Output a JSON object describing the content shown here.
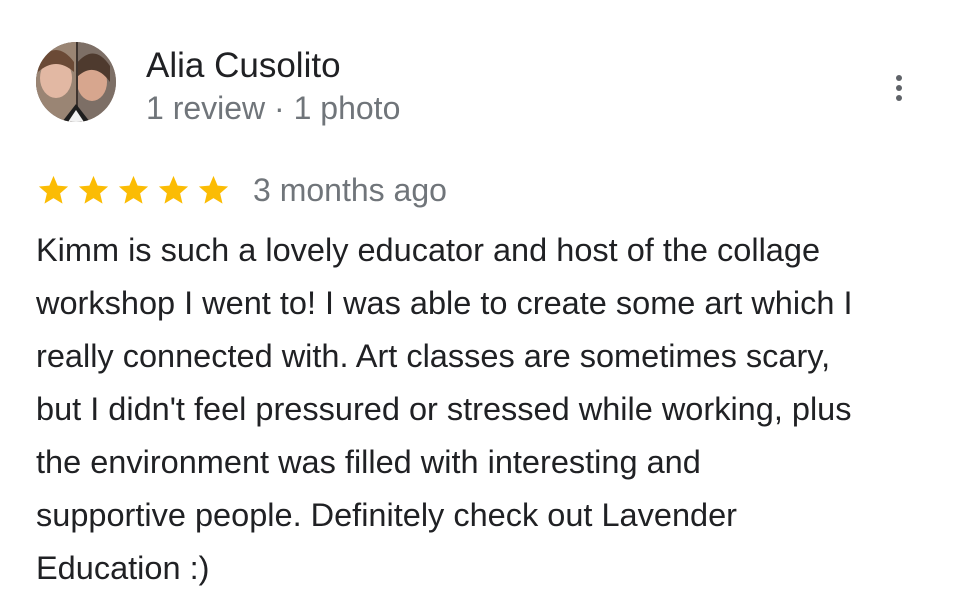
{
  "review": {
    "author": {
      "name": "Alia Cusolito",
      "meta": "1 review · 1 photo",
      "avatar_icon": "profile-photo"
    },
    "menu_icon": "more-vert-icon",
    "rating": {
      "stars": 5,
      "max_stars": 5,
      "star_color": "#fbbc04",
      "date": "3 months ago"
    },
    "text_lines": [
      "Kimm is such a lovely educator and host of the collage",
      "workshop I went to! I was able to create some art which I",
      "really connected with. Art classes are sometimes scary,",
      "but I didn't feel pressured or stressed while working, plus",
      "the environment was filled with interesting and",
      "supportive people. Definitely check out Lavender",
      "Education :)"
    ]
  },
  "colors": {
    "primary_text": "#202124",
    "secondary_text": "#70757a",
    "icon_gray": "#5f6368"
  }
}
